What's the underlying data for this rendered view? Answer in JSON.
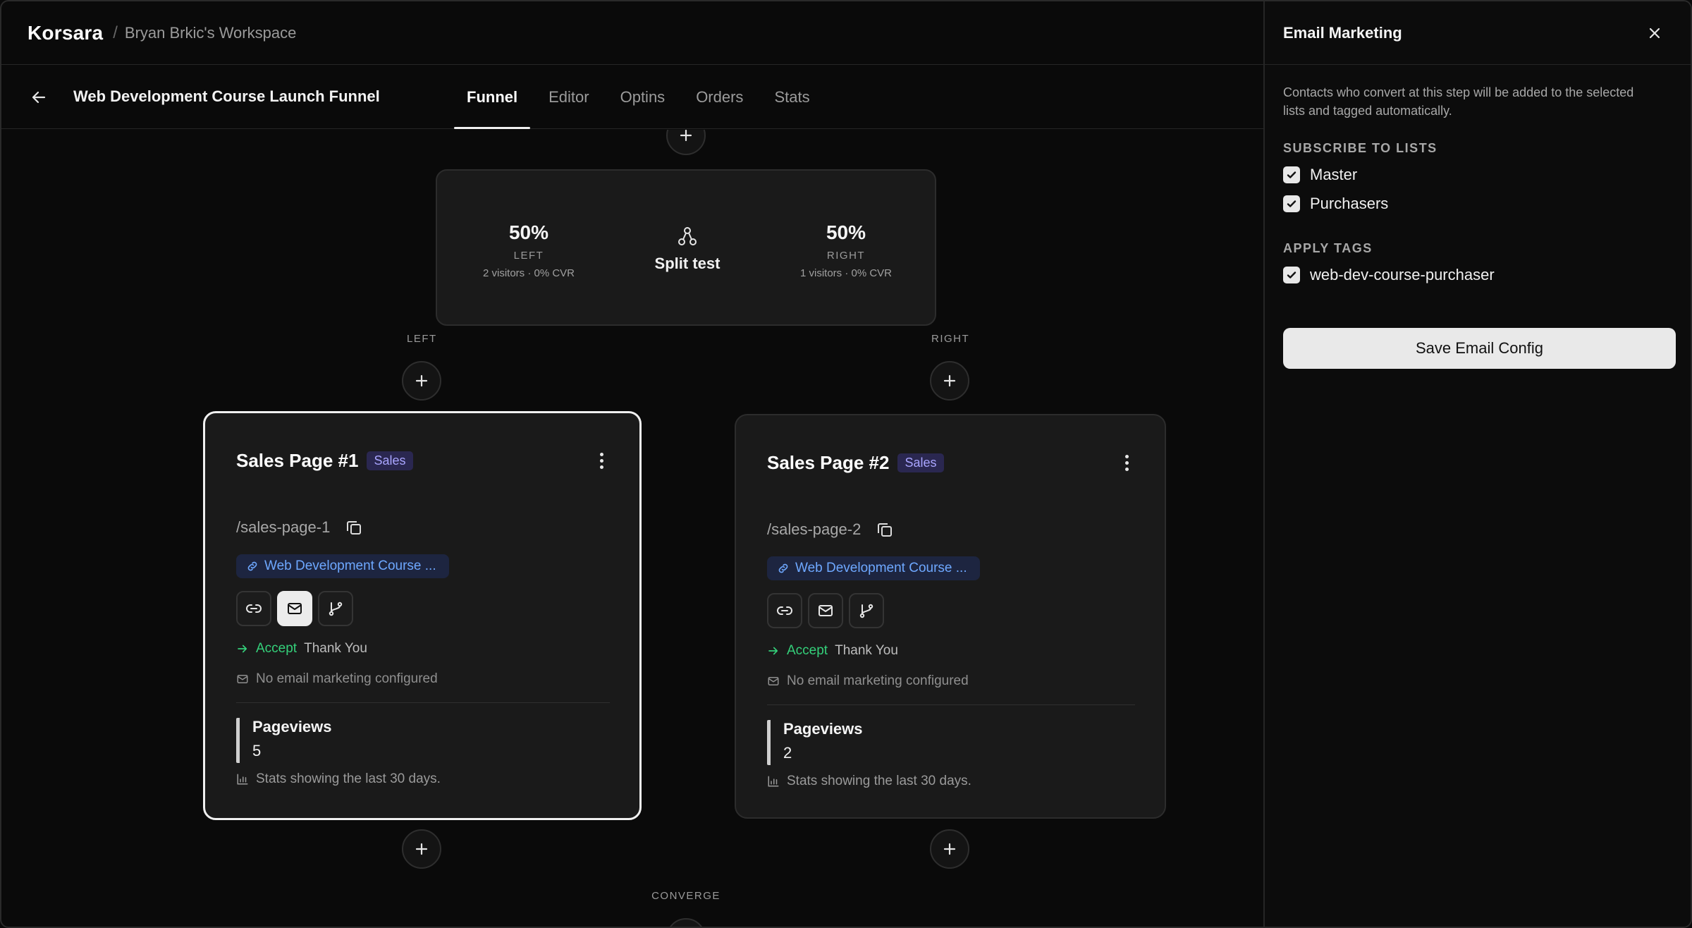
{
  "topbar": {
    "brand": "Korsara",
    "separator": "/",
    "workspace": "Bryan Brkic's Workspace"
  },
  "subbar": {
    "title": "Web Development Course Launch Funnel",
    "tabs": [
      {
        "label": "Funnel",
        "active": true
      },
      {
        "label": "Editor",
        "active": false
      },
      {
        "label": "Optins",
        "active": false
      },
      {
        "label": "Orders",
        "active": false
      },
      {
        "label": "Stats",
        "active": false
      }
    ]
  },
  "split": {
    "left": {
      "percent": "50%",
      "label": "LEFT",
      "sub": "2 visitors · 0% CVR"
    },
    "center": "Split test",
    "right": {
      "percent": "50%",
      "label": "RIGHT",
      "sub": "1 visitors · 0% CVR"
    }
  },
  "branches": {
    "left": "LEFT",
    "right": "RIGHT",
    "converge": "CONVERGE"
  },
  "cards": [
    {
      "title": "Sales Page #1",
      "badge": "Sales",
      "slug": "/sales-page-1",
      "link": "Web Development Course ...",
      "accept_label": "Accept",
      "accept_target": "Thank You",
      "email_note": "No email marketing configured",
      "stat_label": "Pageviews",
      "stat_value": "5",
      "stat_note": "Stats showing the last 30 days.",
      "selected": true
    },
    {
      "title": "Sales Page #2",
      "badge": "Sales",
      "slug": "/sales-page-2",
      "link": "Web Development Course ...",
      "accept_label": "Accept",
      "accept_target": "Thank You",
      "email_note": "No email marketing configured",
      "stat_label": "Pageviews",
      "stat_value": "2",
      "stat_note": "Stats showing the last 30 days.",
      "selected": false
    }
  ],
  "panel": {
    "title": "Email Marketing",
    "description": "Contacts who convert at this step will be added to the selected lists and tagged automatically.",
    "lists_heading": "SUBSCRIBE TO LISTS",
    "lists": [
      {
        "label": "Master",
        "checked": true
      },
      {
        "label": "Purchasers",
        "checked": true
      }
    ],
    "tags_heading": "APPLY TAGS",
    "tags": [
      {
        "label": "web-dev-course-purchaser",
        "checked": true
      }
    ],
    "save_label": "Save Email Config"
  },
  "colors": {
    "accent_green": "#34d07a",
    "link_blue": "#6ea8ff",
    "badge_purple": "#a9a5ff"
  }
}
